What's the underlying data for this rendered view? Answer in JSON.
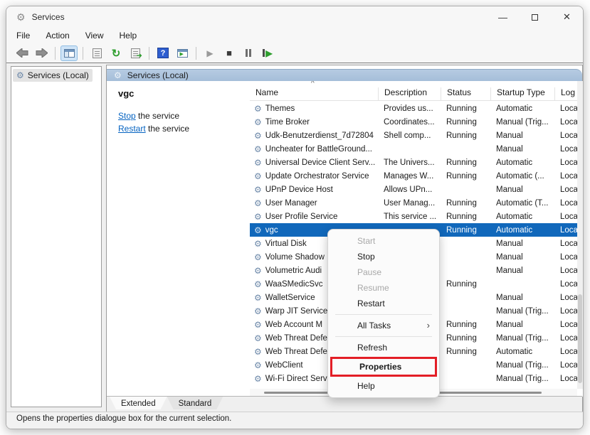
{
  "window": {
    "title": "Services",
    "controls": {
      "minimize": "—",
      "maximize": "",
      "close": "✕"
    },
    "menus": [
      "File",
      "Action",
      "View",
      "Help"
    ]
  },
  "toolbar": {
    "buttons": [
      "back",
      "forward",
      "show-console-tree",
      "properties",
      "refresh",
      "export-list",
      "help",
      "new-window",
      "start-service",
      "stop-service",
      "pause-service",
      "restart-service"
    ],
    "refresh_glyph": "↻",
    "help_glyph": "?",
    "play_glyph": "▶",
    "stop_glyph": "■"
  },
  "tree": {
    "root_label": "Services (Local)"
  },
  "panel": {
    "header": "Services (Local)",
    "selected_service": "vgc",
    "links": [
      {
        "action": "Stop",
        "rest": " the service"
      },
      {
        "action": "Restart",
        "rest": " the service"
      }
    ]
  },
  "table": {
    "columns": [
      "Name",
      "Description",
      "Status",
      "Startup Type",
      "Log"
    ],
    "sort_indicator": "^",
    "rows": [
      {
        "name": "Themes",
        "description": "Provides us...",
        "status": "Running",
        "startup": "Automatic",
        "logon": "Loca"
      },
      {
        "name": "Time Broker",
        "description": "Coordinates...",
        "status": "Running",
        "startup": "Manual (Trig...",
        "logon": "Loca"
      },
      {
        "name": "Udk-Benutzerdienst_7d72804",
        "description": "Shell comp...",
        "status": "Running",
        "startup": "Manual",
        "logon": "Loca"
      },
      {
        "name": "Uncheater for BattleGround...",
        "description": "",
        "status": "",
        "startup": "Manual",
        "logon": "Loca"
      },
      {
        "name": "Universal Device Client Serv...",
        "description": "The Univers...",
        "status": "Running",
        "startup": "Automatic",
        "logon": "Loca"
      },
      {
        "name": "Update Orchestrator Service",
        "description": "Manages W...",
        "status": "Running",
        "startup": "Automatic (...",
        "logon": "Loca"
      },
      {
        "name": "UPnP Device Host",
        "description": "Allows UPn...",
        "status": "",
        "startup": "Manual",
        "logon": "Loca"
      },
      {
        "name": "User Manager",
        "description": "User Manag...",
        "status": "Running",
        "startup": "Automatic (T...",
        "logon": "Loca"
      },
      {
        "name": "User Profile Service",
        "description": "This service ...",
        "status": "Running",
        "startup": "Automatic",
        "logon": "Loca"
      },
      {
        "name": "vgc",
        "description": "",
        "status": "Running",
        "startup": "Automatic",
        "logon": "Loca",
        "selected": true
      },
      {
        "name": "Virtual Disk",
        "description": "",
        "status": "",
        "startup": "Manual",
        "logon": "Loca"
      },
      {
        "name": "Volume Shadow",
        "description": "",
        "status": "",
        "startup": "Manual",
        "logon": "Loca"
      },
      {
        "name": "Volumetric Audi",
        "description": "",
        "status": "",
        "startup": "Manual",
        "logon": "Loca"
      },
      {
        "name": "WaaSMedicSvc",
        "description": "",
        "status": "Running",
        "startup": "",
        "logon": "Loca"
      },
      {
        "name": "WalletService",
        "description": "",
        "status": "",
        "startup": "Manual",
        "logon": "Loca"
      },
      {
        "name": "Warp JIT Service",
        "description": "",
        "status": "",
        "startup": "Manual (Trig...",
        "logon": "Loca"
      },
      {
        "name": "Web Account M",
        "description": "",
        "status": "Running",
        "startup": "Manual",
        "logon": "Loca"
      },
      {
        "name": "Web Threat Defe",
        "description": "",
        "status": "Running",
        "startup": "Manual (Trig...",
        "logon": "Loca"
      },
      {
        "name": "Web Threat Defe",
        "description": "",
        "status": "Running",
        "startup": "Automatic",
        "logon": "Loca"
      },
      {
        "name": "WebClient",
        "description": "",
        "status": "",
        "startup": "Manual (Trig...",
        "logon": "Loca"
      },
      {
        "name": "Wi-Fi Direct Serv",
        "description": "",
        "status": "",
        "startup": "Manual (Trig...",
        "logon": "Loca"
      }
    ]
  },
  "context_menu": {
    "items": [
      {
        "label": "Start",
        "disabled": true
      },
      {
        "label": "Stop"
      },
      {
        "label": "Pause",
        "disabled": true
      },
      {
        "label": "Resume",
        "disabled": true
      },
      {
        "label": "Restart"
      },
      {
        "separator": true
      },
      {
        "label": "All Tasks",
        "submenu": true,
        "submenu_glyph": "›"
      },
      {
        "separator": true
      },
      {
        "label": "Refresh"
      },
      {
        "label": "Properties",
        "bold": true,
        "highlighted": true
      },
      {
        "label": "Help"
      }
    ]
  },
  "tabs": [
    {
      "label": "Extended",
      "selected": true
    },
    {
      "label": "Standard"
    }
  ],
  "status_bar": "Opens the properties dialogue box for the current selection.",
  "colors": {
    "selection_blue": "#1168bb",
    "highlight_red": "#e31e26",
    "header_blue": "#aec5dd",
    "link_blue": "#0563c1"
  }
}
